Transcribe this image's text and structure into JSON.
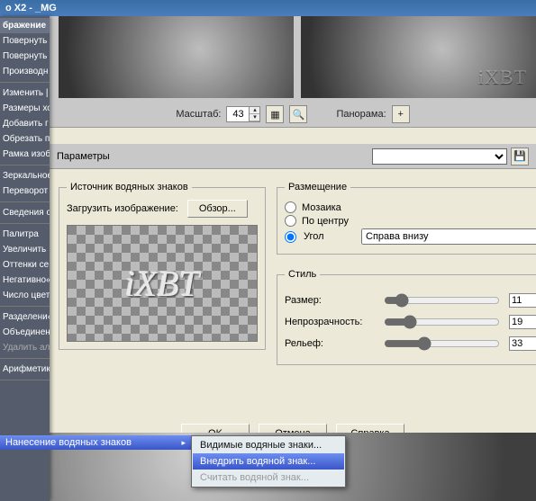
{
  "titlebar": {
    "title": "o X2 - _MG"
  },
  "sidemenu": {
    "header": "бражение",
    "items": [
      "Повернуть",
      "Повернуть",
      "Производн",
      "Изменить |",
      "Размеры хо",
      "Добавить г",
      "Обрезать п",
      "Рамка изоб",
      "Зеркальное",
      "Переворот",
      "Сведения о",
      "Палитра",
      "Увеличить",
      "Оттенки се",
      "Негативно«",
      "Число цвет",
      "Разделени«",
      "Объединен"
    ],
    "disabled_item": "Удалить ал",
    "arithmetic": "Арифметик",
    "watermark_item": "Нанесение водяных знаков"
  },
  "zoombar": {
    "scale_label": "Масштаб:",
    "scale_value": "43",
    "panorama_label": "Панорама:",
    "plus": "+"
  },
  "paramstrip": {
    "label": "Параметры"
  },
  "watermark_preview_text": "iXBT",
  "preview_wm_text": "iXBT",
  "source": {
    "legend": "Источник водяных знаков",
    "load_label": "Загрузить изображение:",
    "browse": "Обзор..."
  },
  "placement": {
    "legend": "Размещение",
    "mosaic": "Мозаика",
    "center": "По центру",
    "corner": "Угол",
    "corner_option": "Справа внизу"
  },
  "style": {
    "legend": "Стиль",
    "size_label": "Размер:",
    "size_value": "11",
    "opacity_label": "Непрозрачность:",
    "opacity_value": "19",
    "relief_label": "Рельеф:",
    "relief_value": "33"
  },
  "buttons": {
    "ok": "OK",
    "cancel": "Отмена",
    "help": "Справка"
  },
  "submenu": {
    "visible": "Видимые водяные знаки...",
    "embed": "Внедрить водяной знак...",
    "read": "Считать водяной знак..."
  },
  "icons": {
    "save": "💾",
    "zoom": "🔍",
    "grid": "▦"
  }
}
